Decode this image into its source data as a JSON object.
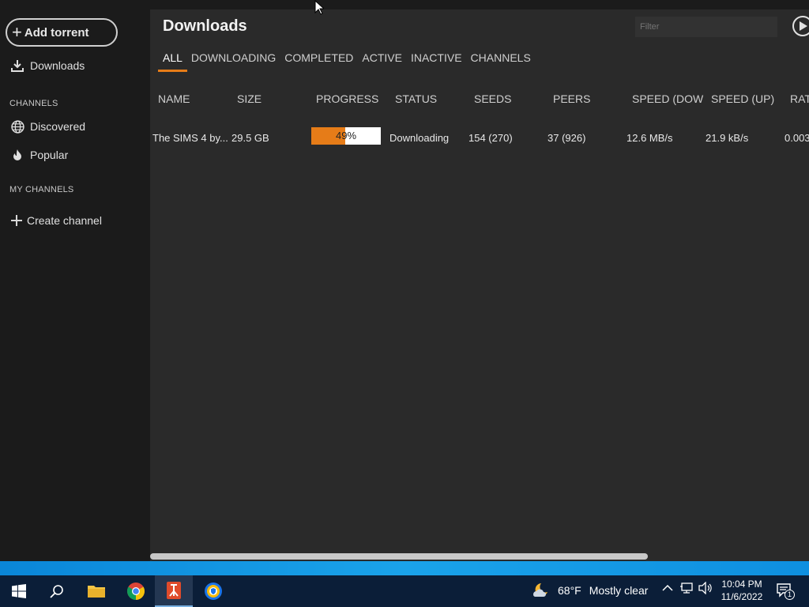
{
  "sidebar": {
    "add_torrent": "Add torrent",
    "downloads": "Downloads",
    "channels_header": "CHANNELS",
    "discovered": "Discovered",
    "popular": "Popular",
    "my_channels_header": "MY CHANNELS",
    "create_channel": "Create channel"
  },
  "main": {
    "title": "Downloads",
    "filter_placeholder": "Filter",
    "tabs": [
      "ALL",
      "DOWNLOADING",
      "COMPLETED",
      "ACTIVE",
      "INACTIVE",
      "CHANNELS"
    ],
    "active_tab": "ALL",
    "columns": [
      "NAME",
      "SIZE",
      "PROGRESS",
      "STATUS",
      "SEEDS",
      "PEERS",
      "SPEED (DOW",
      "SPEED (UP)",
      "RAT"
    ],
    "rows": [
      {
        "name": "The SIMS 4 by...",
        "size": "29.5 GB",
        "progress_text": "49%",
        "progress_value": 0.49,
        "status": "Downloading",
        "seeds": "154 (270)",
        "peers": "37 (926)",
        "speed_down": "12.6 MB/s",
        "speed_up": "21.9 kB/s",
        "ratio": "0.003"
      }
    ]
  },
  "taskbar": {
    "weather_temp": "68°F",
    "weather_desc": "Mostly clear",
    "time": "10:04 PM",
    "date": "11/6/2022",
    "notification_count": "1",
    "accent_color": "#e67c18"
  }
}
